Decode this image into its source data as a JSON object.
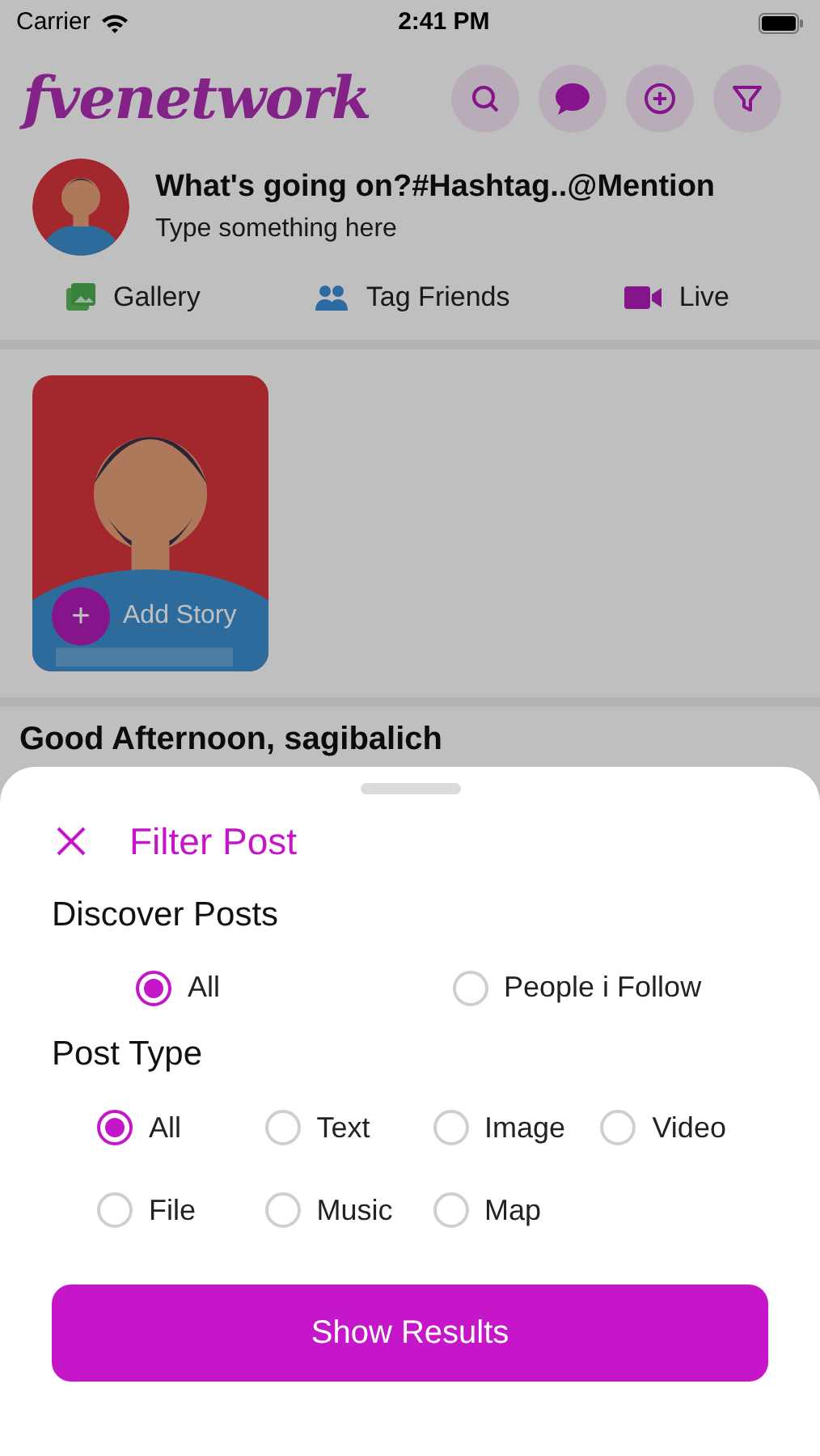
{
  "status_bar": {
    "carrier": "Carrier",
    "time": "2:41 PM"
  },
  "header": {
    "logo": "fvenetwork"
  },
  "composer": {
    "title": "What's going on?#Hashtag..@Mention",
    "placeholder": "Type something here",
    "actions": [
      {
        "label": "Gallery",
        "kind": "gallery"
      },
      {
        "label": "Tag Friends",
        "kind": "friends"
      },
      {
        "label": "Live",
        "kind": "live"
      }
    ]
  },
  "stories": [
    {
      "label": "Add Story",
      "button": "+"
    }
  ],
  "greeting": "Good Afternoon, sagibalich",
  "sheet": {
    "title": "Filter Post",
    "sections": [
      {
        "title": "Discover Posts",
        "kind": "wide",
        "options": [
          {
            "label": "All",
            "selected": true
          },
          {
            "label": "People i Follow",
            "selected": false
          }
        ]
      },
      {
        "title": "Post Type",
        "kind": "grid",
        "options": [
          {
            "label": "All",
            "selected": true
          },
          {
            "label": "Text",
            "selected": false
          },
          {
            "label": "Image",
            "selected": false
          },
          {
            "label": "Video",
            "selected": false
          },
          {
            "label": "File",
            "selected": false
          },
          {
            "label": "Music",
            "selected": false
          },
          {
            "label": "Map",
            "selected": false
          }
        ]
      }
    ],
    "button": "Show Results"
  }
}
